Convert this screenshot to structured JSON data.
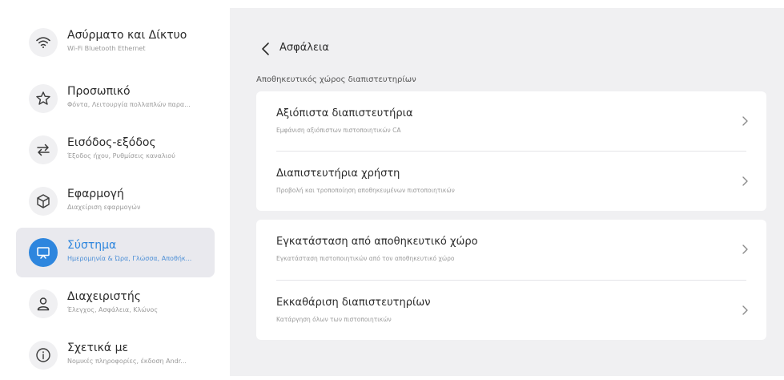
{
  "sidebar": {
    "items": [
      {
        "icon": "wifi-icon",
        "title": "Ασύρματο και Δίκτυο",
        "subtitle": "Wi-Fi Bluetooth Ethernet"
      },
      {
        "icon": "star-icon",
        "title": "Προσωπικό",
        "subtitle": "Φόντα, Λειτουργία πολλαπλών παρα..."
      },
      {
        "icon": "swap-icon",
        "title": "Εισόδος-εξόδος",
        "subtitle": "Έξοδος ήχου, Ρυθμίσεις καναλιού"
      },
      {
        "icon": "cube-icon",
        "title": "Εφαρμογή",
        "subtitle": "Διαχείριση εφαρμογών"
      },
      {
        "icon": "monitor-icon",
        "title": "Σύστημα",
        "subtitle": "Ημερομηνία & Ώρα, Γλώσσα, Αποθήκ...",
        "active": true
      },
      {
        "icon": "person-icon",
        "title": "Διαχειριστής",
        "subtitle": "Έλεγχος, Ασφάλεια, Κλώνος"
      },
      {
        "icon": "info-icon",
        "title": "Σχετικά με",
        "subtitle": "Νομικές πληροφορίες, έκδοση Andr..."
      }
    ]
  },
  "header": {
    "back_label": "Ασφάλεια"
  },
  "section": {
    "title": "Αποθηκευτικός χώρος διαπιστευτηρίων"
  },
  "card1": {
    "rows": [
      {
        "title": "Αξιόπιστα διαπιστευτήρια",
        "subtitle": "Εμφάνιση αξιόπιστων πιστοποιητικών CA"
      },
      {
        "title": "Διαπιστευτήρια χρήστη",
        "subtitle": "Προβολή και τροποποίηση αποθηκευμένων πιστοποιητικών"
      }
    ]
  },
  "card2": {
    "rows": [
      {
        "title": "Εγκατάσταση από αποθηκευτικό χώρο",
        "subtitle": "Εγκατάσταση πιστοποιητικών από τον αποθηκευτικό χώρο"
      },
      {
        "title": "Εκκαθάριση διαπιστευτηρίων",
        "subtitle": "Κατάργηση όλων των πιστοποιητικών"
      }
    ]
  },
  "colors": {
    "accent": "#2e86de",
    "content_bg": "#f0f0f2",
    "active_bg": "#e9e9ee"
  }
}
